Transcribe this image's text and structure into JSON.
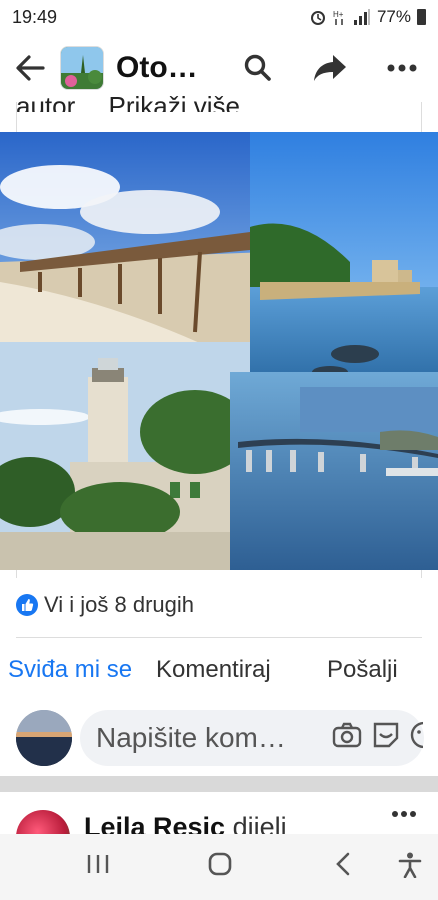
{
  "status_bar": {
    "time": "19:49",
    "battery_percent": "77%"
  },
  "header": {
    "title": "Oto…"
  },
  "post": {
    "truncated_text": "autor…",
    "see_more": "Prikaži više",
    "reactions_text": "Vi i još 8 drugih"
  },
  "actions": {
    "like": "Sviđa mi se",
    "comment": "Komentiraj",
    "share": "Pošalji"
  },
  "comment_input": {
    "placeholder": "Napišite kom…"
  },
  "next_post": {
    "author": "Leila Resic",
    "verb": "dijeli"
  },
  "colors": {
    "accent": "#1877f2",
    "input_bg": "#f0f2f5",
    "divider": "#dddddd"
  }
}
